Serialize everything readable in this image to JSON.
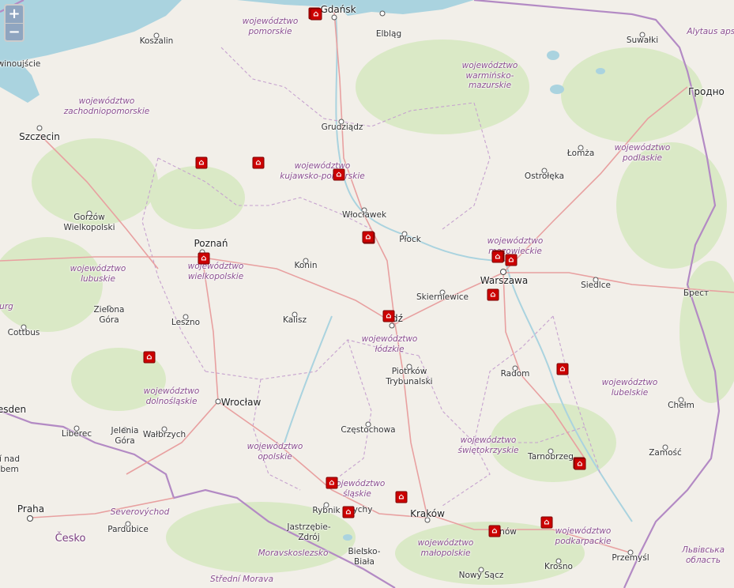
{
  "zoom": {
    "in_label": "+",
    "out_label": "−"
  },
  "colors": {
    "water": "#aad3df",
    "land": "#f2efe9",
    "forest": "#d6e8c0",
    "border": "#b38ac4",
    "road": "#e8a0a0",
    "marker": "#cc0000"
  },
  "marker_icon": "traffic-camera-icon",
  "labels": [
    {
      "name": "gdansk",
      "text": "Gdańsk",
      "type": "city"
    },
    {
      "name": "elblag",
      "text": "Elbląg",
      "type": "town"
    },
    {
      "name": "koszalin",
      "text": "Koszalin",
      "type": "town"
    },
    {
      "name": "suwalki",
      "text": "Suwałki",
      "type": "town"
    },
    {
      "name": "alytaus",
      "text": "Alytaus apskr",
      "type": "foreign"
    },
    {
      "name": "swinoujscie",
      "text": "winoujście",
      "type": "town"
    },
    {
      "name": "pomorskie",
      "text": "województwo\npomorskie",
      "type": "region"
    },
    {
      "name": "warminsko",
      "text": "województwo\nwarmińsko-\nmazurskie",
      "type": "region"
    },
    {
      "name": "grodno",
      "text": "Гродно",
      "type": "city"
    },
    {
      "name": "zachodniopomorskie",
      "text": "województwo\nzachodniopomorskie",
      "type": "region"
    },
    {
      "name": "szczecin",
      "text": "Szczecin",
      "type": "city"
    },
    {
      "name": "grudziadz",
      "text": "Grudziądz",
      "type": "town"
    },
    {
      "name": "lomza",
      "text": "Łomża",
      "type": "town"
    },
    {
      "name": "podlaskie",
      "text": "województwo\npodlaskie",
      "type": "region"
    },
    {
      "name": "kujawsko",
      "text": "województwo\nkujawsko-pomorskie",
      "type": "region"
    },
    {
      "name": "ostroleka",
      "text": "Ostrołęka",
      "type": "town"
    },
    {
      "name": "wloclawek",
      "text": "Włocławek",
      "type": "town"
    },
    {
      "name": "gorzow",
      "text": "Gorzów\nWielkopolski",
      "type": "town"
    },
    {
      "name": "plock",
      "text": "Płock",
      "type": "town"
    },
    {
      "name": "poznan",
      "text": "Poznań",
      "type": "city"
    },
    {
      "name": "mazowieckie",
      "text": "województwo\nmazowieckie",
      "type": "region"
    },
    {
      "name": "konin",
      "text": "Konin",
      "type": "town"
    },
    {
      "name": "lubuskie",
      "text": "województwo\nlubuskie",
      "type": "region"
    },
    {
      "name": "wielkopolskie",
      "text": "województwo\nwielkopolskie",
      "type": "region"
    },
    {
      "name": "warszawa",
      "text": "Warszawa",
      "type": "city"
    },
    {
      "name": "siedlce",
      "text": "Siedlce",
      "type": "town"
    },
    {
      "name": "brest",
      "text": "Брест",
      "type": "town"
    },
    {
      "name": "urg",
      "text": "urg",
      "type": "foreign"
    },
    {
      "name": "skierniewice",
      "text": "Skierniewice",
      "type": "town"
    },
    {
      "name": "zielona",
      "text": "Zielona\nGóra",
      "type": "town"
    },
    {
      "name": "leszno",
      "text": "Leszno",
      "type": "town"
    },
    {
      "name": "kalisz",
      "text": "Kalisz",
      "type": "town"
    },
    {
      "name": "lodz",
      "text": "dź",
      "type": "city"
    },
    {
      "name": "cottbus",
      "text": "Cottbus",
      "type": "town"
    },
    {
      "name": "lodzkie",
      "text": "województwo\nłódzkie",
      "type": "region"
    },
    {
      "name": "piotrkow",
      "text": "Piotrków\nTrybunalski",
      "type": "town"
    },
    {
      "name": "radom",
      "text": "Radom",
      "type": "town"
    },
    {
      "name": "lubelskie",
      "text": "województwo\nlubelskie",
      "type": "region"
    },
    {
      "name": "dolnoslaskie",
      "text": "województwo\ndolnośląskie",
      "type": "region"
    },
    {
      "name": "wroclaw",
      "text": "Wrocław",
      "type": "city"
    },
    {
      "name": "chelm",
      "text": "Chełm",
      "type": "town"
    },
    {
      "name": "esden",
      "text": "esden",
      "type": "city"
    },
    {
      "name": "liberec",
      "text": "Liberec",
      "type": "town"
    },
    {
      "name": "jelenia",
      "text": "Jelenia\nGóra",
      "type": "town"
    },
    {
      "name": "walbrzych",
      "text": "Wałbrzych",
      "type": "town"
    },
    {
      "name": "czestochowa",
      "text": "Częstochowa",
      "type": "town"
    },
    {
      "name": "swietokrzyskie",
      "text": "województwo\nświętokrzyskie",
      "type": "region"
    },
    {
      "name": "opolskie",
      "text": "województwo\nopolskie",
      "type": "region"
    },
    {
      "name": "tarnobrzeg",
      "text": "Tarnobrzeg",
      "type": "town"
    },
    {
      "name": "zamosc",
      "text": "Zamość",
      "type": "town"
    },
    {
      "name": "nadbem",
      "text": "í nad\nbem",
      "type": "town"
    },
    {
      "name": "slaskie",
      "text": "województwo\nśląskie",
      "type": "region"
    },
    {
      "name": "praha",
      "text": "Praha",
      "type": "city"
    },
    {
      "name": "severovychod",
      "text": "Severovýchod",
      "type": "foreign"
    },
    {
      "name": "rybnik",
      "text": "Rybnik",
      "type": "town"
    },
    {
      "name": "tychy",
      "text": "ychy",
      "type": "town"
    },
    {
      "name": "krakow",
      "text": "Kraków",
      "type": "city"
    },
    {
      "name": "tarnow",
      "text": "nów",
      "type": "town"
    },
    {
      "name": "podkarpackie",
      "text": "województwo\npodkarpackie",
      "type": "region"
    },
    {
      "name": "pardubice",
      "text": "Pardubice",
      "type": "town"
    },
    {
      "name": "jastrzebie",
      "text": "Jastrzębie-\nZdrój",
      "type": "town"
    },
    {
      "name": "cesko",
      "text": "Česko",
      "type": "country"
    },
    {
      "name": "malopolskie",
      "text": "województwo\nmałopolskie",
      "type": "region"
    },
    {
      "name": "lwowska",
      "text": "Львівська\nобласть",
      "type": "foreign"
    },
    {
      "name": "moravskoslezsko",
      "text": "Moravskoslezsko",
      "type": "foreign"
    },
    {
      "name": "bielsko",
      "text": "Bielsko-\nBiała",
      "type": "town"
    },
    {
      "name": "przemysl",
      "text": "Przemyśl",
      "type": "town"
    },
    {
      "name": "krosno",
      "text": "Krosno",
      "type": "town"
    },
    {
      "name": "nowysacz",
      "text": "Nowy Sącz",
      "type": "town"
    },
    {
      "name": "strednimorava",
      "text": "Střední Morava",
      "type": "foreign"
    }
  ],
  "markers": 22
}
